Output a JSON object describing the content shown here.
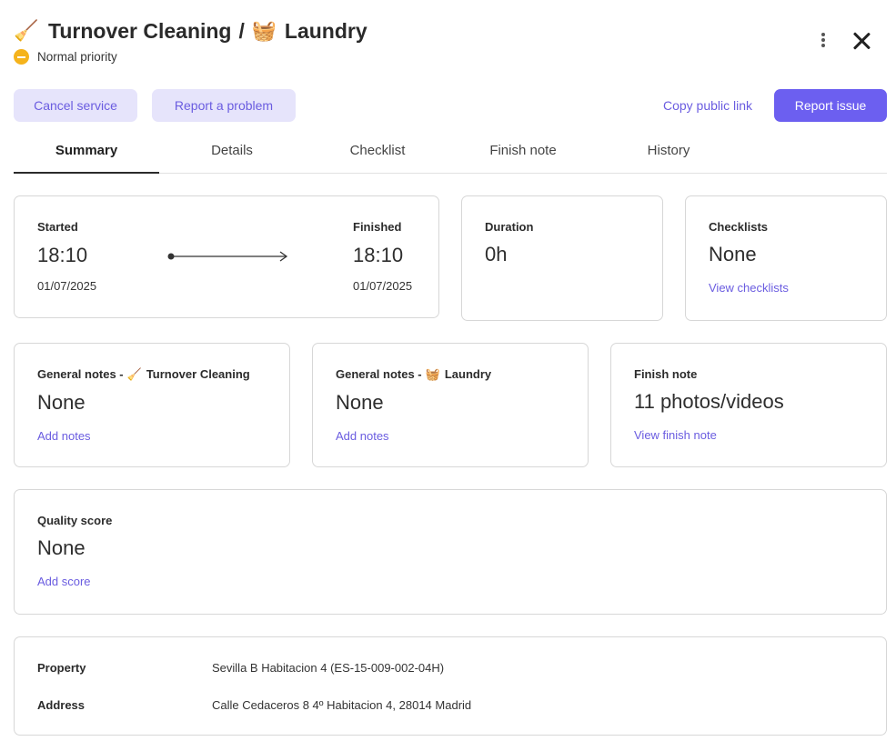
{
  "header": {
    "service1_emoji": "🧹",
    "service1": "Turnover Cleaning",
    "separator": "/",
    "service2_emoji": "🧺",
    "service2": "Laundry",
    "priority": "Normal priority"
  },
  "actions": {
    "cancel": "Cancel service",
    "problem": "Report a problem",
    "copy_link": "Copy public link",
    "report_issue": "Report issue"
  },
  "tabs": [
    {
      "label": "Summary"
    },
    {
      "label": "Details"
    },
    {
      "label": "Checklist"
    },
    {
      "label": "Finish note"
    },
    {
      "label": "History"
    }
  ],
  "summary": {
    "started": {
      "label": "Started",
      "time": "18:10",
      "date": "01/07/2025"
    },
    "finished": {
      "label": "Finished",
      "time": "18:10",
      "date": "01/07/2025"
    },
    "duration": {
      "label": "Duration",
      "value": "0h"
    },
    "checklists": {
      "label": "Checklists",
      "value": "None",
      "link": "View checklists"
    },
    "note1": {
      "label": "General notes -",
      "emoji": "🧹",
      "service": "Turnover Cleaning",
      "value": "None",
      "link": "Add notes"
    },
    "note2": {
      "label": "General notes -",
      "emoji": "🧺",
      "service": "Laundry",
      "value": "None",
      "link": "Add notes"
    },
    "finish_note": {
      "label": "Finish note",
      "value": "11 photos/videos",
      "link": "View finish note"
    },
    "quality": {
      "label": "Quality score",
      "value": "None",
      "link": "Add score"
    }
  },
  "property": {
    "property_label": "Property",
    "property_value": "Sevilla B Habitacion 4 (ES-15-009-002-04H)",
    "address_label": "Address",
    "address_value": "Calle Cedaceros 8 4º Habitacion 4, 28014 Madrid"
  },
  "colors": {
    "accent": "#6c5ff0",
    "soft_button": "#e6e4fb",
    "priority": "#f5b31c"
  }
}
